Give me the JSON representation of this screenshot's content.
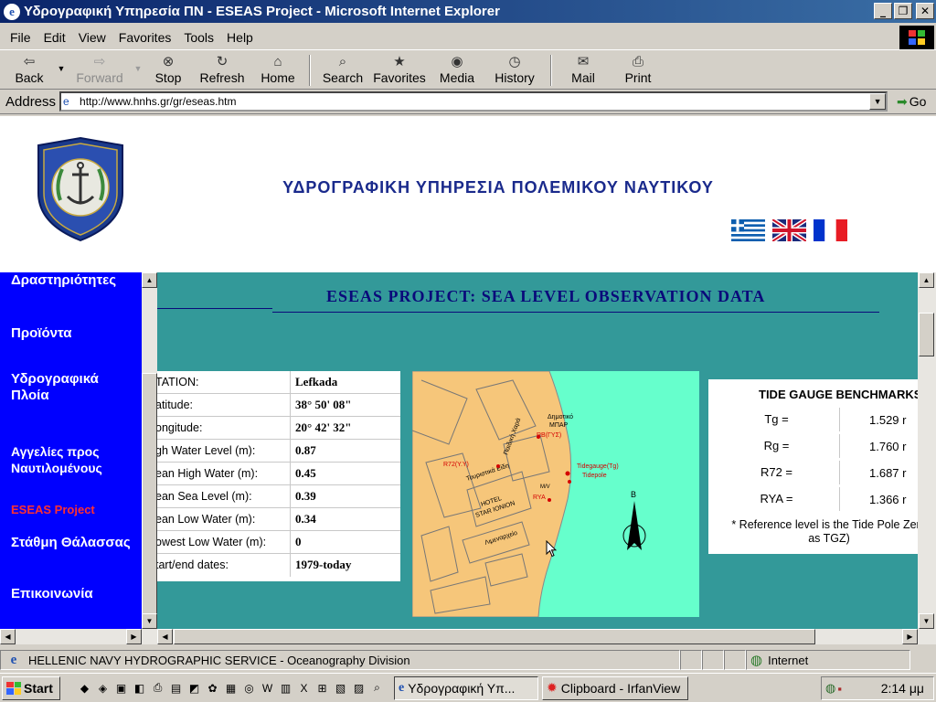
{
  "window": {
    "title": "Υδρογραφική Υπηρεσία ΠΝ - ESEAS Project - Microsoft Internet Explorer",
    "minimize": "_",
    "restore": "❐",
    "close": "✕"
  },
  "menu": [
    {
      "label": "File"
    },
    {
      "label": "Edit"
    },
    {
      "label": "View"
    },
    {
      "label": "Favorites"
    },
    {
      "label": "Tools"
    },
    {
      "label": "Help"
    }
  ],
  "toolbar": {
    "back": {
      "label": "Back",
      "icon": "back-arrow-icon"
    },
    "forward": {
      "label": "Forward",
      "icon": "forward-arrow-icon"
    },
    "stop": {
      "label": "Stop",
      "icon": "stop-icon"
    },
    "refresh": {
      "label": "Refresh",
      "icon": "refresh-icon"
    },
    "home": {
      "label": "Home",
      "icon": "home-icon"
    },
    "search": {
      "label": "Search",
      "icon": "search-icon"
    },
    "favorites": {
      "label": "Favorites",
      "icon": "favorites-icon"
    },
    "media": {
      "label": "Media",
      "icon": "media-icon"
    },
    "history": {
      "label": "History",
      "icon": "history-icon"
    },
    "mail": {
      "label": "Mail",
      "icon": "mail-icon"
    },
    "print": {
      "label": "Print",
      "icon": "print-icon"
    }
  },
  "address": {
    "label": "Address",
    "url": "http://www.hnhs.gr/gr/eseas.htm",
    "go": "Go"
  },
  "header": {
    "site_title": "ΥΔΡΟΓΡΑΦΙΚΗ ΥΠΗΡΕΣΙΑ ΠΟΛΕΜΙΚΟΥ ΝΑΥΤΙΚΟΥ",
    "flags": [
      "greek-flag",
      "uk-flag",
      "french-flag"
    ]
  },
  "nav": [
    {
      "label": "Δραστηριότητες"
    },
    {
      "label": "Προϊόντα"
    },
    {
      "label": "Υδρογραφικά Πλοία"
    },
    {
      "label": "Αγγελίες προς Ναυτιλομένους"
    },
    {
      "label": "ESEAS Project"
    },
    {
      "label": "Στάθμη Θάλασσας"
    },
    {
      "label": "Επικοινωνία"
    }
  ],
  "main": {
    "section_title": "ESEAS PROJECT: SEA LEVEL OBSERVATION DATA",
    "station": [
      {
        "label": "TATION:",
        "value": "Lefkada"
      },
      {
        "label": "atitude:",
        "value": "38° 50' 08\""
      },
      {
        "label": "ongitude:",
        "value": "20° 42' 32\""
      },
      {
        "label": "gh Water Level (m):",
        "value": "0.87"
      },
      {
        "label": "ean High Water (m):",
        "value": "0.45"
      },
      {
        "label": "ean Sea Level (m):",
        "value": "0.39"
      },
      {
        "label": "ean Low Water (m):",
        "value": "0.34"
      },
      {
        "label": "owest Low Water (m):",
        "value": "0"
      },
      {
        "label": "tart/end dates:",
        "value": "1979-today"
      }
    ],
    "map_labels": {
      "municipal": "Δημοτικό",
      "bar": "ΜΠΑΡ",
      "rb": "RB(ΓΥΣ)",
      "r72": "R72(Y.Y)",
      "tidegauge": "Tidegauge(Tg)",
      "tidepole": "Tidepole",
      "rya": "RYA",
      "tourist": "Τουριστικά Είδη",
      "hotel": "HOTEL",
      "star": "STAR IONION",
      "harbour": "Λιμεναρχείο",
      "play": "Παιδική Χαρά",
      "b": "B",
      "mv": "M/V"
    },
    "benchmarks": {
      "title": "TIDE GAUGE BENCHMARKS",
      "rows": [
        {
          "key": "Tg =",
          "value": "1.529 r"
        },
        {
          "key": "Rg =",
          "value": "1.760 r"
        },
        {
          "key": "R72 =",
          "value": "1.687 r"
        },
        {
          "key": "RYA =",
          "value": "1.366 r"
        }
      ],
      "note_line1": "* Reference level is the Tide Pole Zero",
      "note_line2": "as TGZ)"
    }
  },
  "status": {
    "text": "HELLENIC NAVY HYDROGRAPHIC SERVICE - Oceanography Division",
    "zone": "Internet"
  },
  "taskbar": {
    "start": "Start",
    "tasks": [
      {
        "label": "Υδρογραφική Υπ...",
        "active": true
      },
      {
        "label": "Clipboard - IrfanView",
        "active": false
      }
    ],
    "clock": "2:14 μμ"
  }
}
